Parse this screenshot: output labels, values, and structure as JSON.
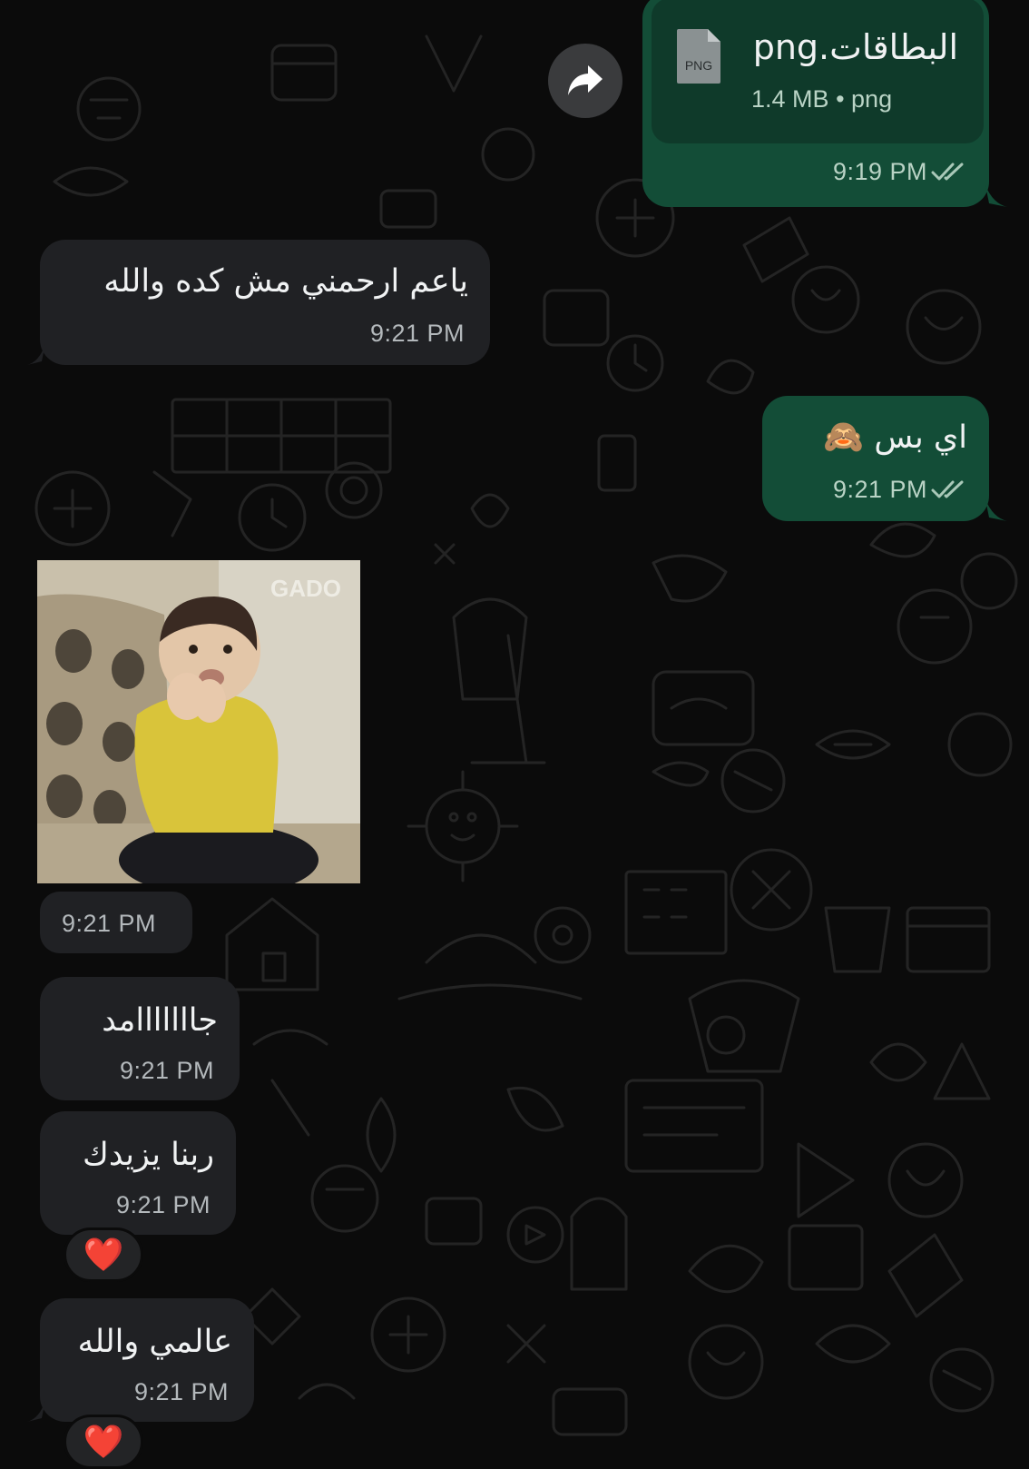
{
  "colors": {
    "background": "#0b0b0b",
    "incoming_bubble": "#202124",
    "outgoing_bubble": "#134d37",
    "read_ticks": "#a9c8b8"
  },
  "messages": [
    {
      "direction": "outgoing",
      "type": "document",
      "file_name": "البطاقات.png",
      "file_badge": "PNG",
      "file_size": "1.4 MB",
      "file_type": "png",
      "time": "9:19 PM",
      "status_icon": "double-check-icon"
    },
    {
      "direction": "incoming",
      "type": "text",
      "text": "ياعم ارحمني مش كده والله",
      "time": "9:21 PM"
    },
    {
      "direction": "outgoing",
      "type": "text",
      "text": "اي بس",
      "emoji": "🙈",
      "time": "9:21 PM",
      "status_icon": "double-check-icon"
    },
    {
      "direction": "incoming",
      "type": "gif",
      "watermark": "GADO",
      "time": "9:21 PM"
    },
    {
      "direction": "incoming",
      "type": "text",
      "text": "جااااااامد",
      "time": "9:21 PM"
    },
    {
      "direction": "incoming",
      "type": "text",
      "text": "ربنا يزيدك",
      "time": "9:21 PM",
      "reaction": "❤️"
    },
    {
      "direction": "incoming",
      "type": "text",
      "text": "عالمي والله",
      "time": "9:21 PM",
      "reaction": "❤️"
    }
  ],
  "icons": {
    "forward": "forward-arrow-icon",
    "file": "png-file-icon",
    "reaction": "red-heart-emoji"
  }
}
